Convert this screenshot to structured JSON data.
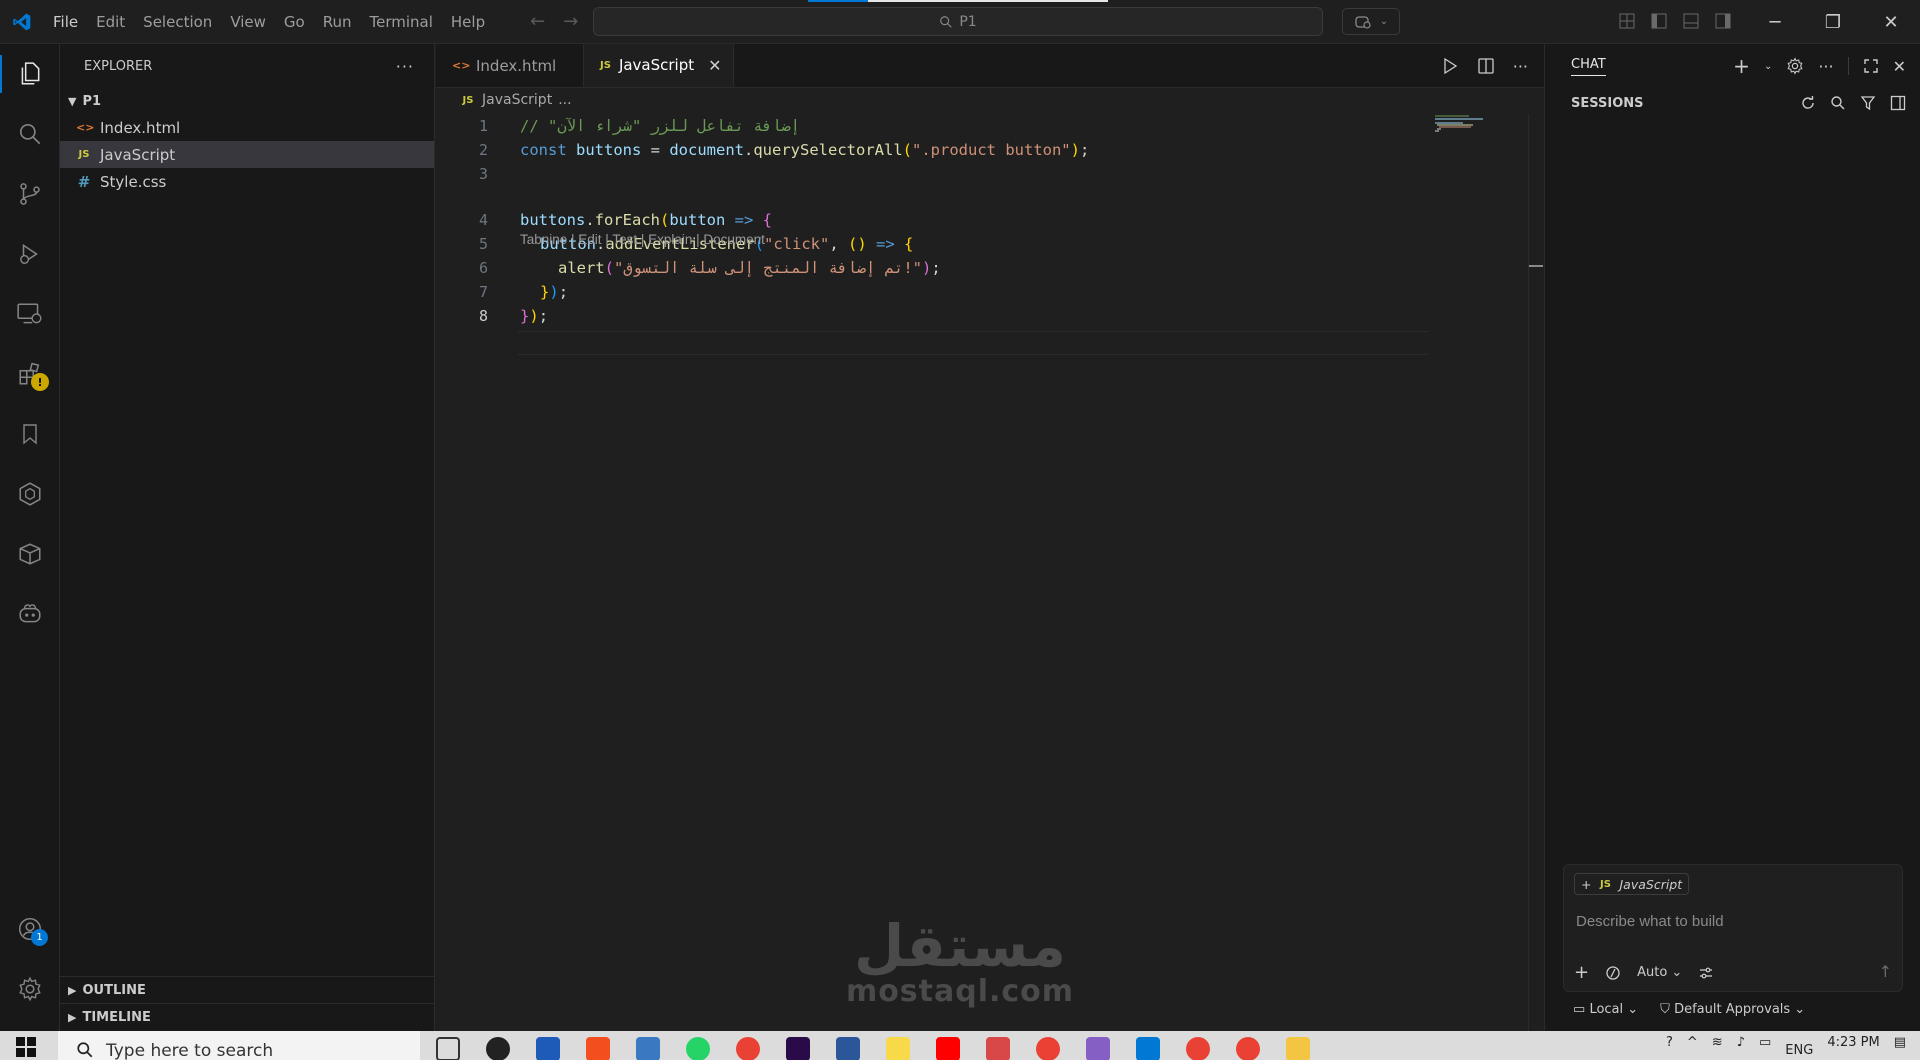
{
  "titlebar": {
    "menu": [
      "File",
      "Edit",
      "Selection",
      "View",
      "Go",
      "Run",
      "Terminal",
      "Help"
    ],
    "search_text": "P1"
  },
  "activity": {
    "accounts_badge": "1"
  },
  "sidebar": {
    "title": "EXPLORER",
    "folder": "P1",
    "files": [
      {
        "name": "Index.html",
        "icon": "html-file-icon"
      },
      {
        "name": "JavaScript",
        "icon": "js-file-icon"
      },
      {
        "name": "Style.css",
        "icon": "css-file-icon"
      }
    ],
    "outline_label": "OUTLINE",
    "timeline_label": "TIMELINE"
  },
  "editor": {
    "tabs": [
      {
        "label": "Index.html",
        "icon_text": "<>"
      },
      {
        "label": "JavaScript",
        "icon_text": "JS"
      }
    ],
    "breadcrumb_icon": "JS",
    "breadcrumb_file": "JavaScript",
    "breadcrumb_more": "...",
    "codelens": "Tabnine | Edit | Test | Explain | Document",
    "line_numbers": [
      "1",
      "2",
      "3",
      "4",
      "5",
      "6",
      "7",
      "8"
    ],
    "code": {
      "l1_comment": "// \"إضافة تفاعل للزر \"شراء الآن",
      "l2_kw": "const",
      "l2_var": "buttons",
      "l2_eq": " = ",
      "l2_obj": "document",
      "l2_dot": ".",
      "l2_fn": "querySelectorAll",
      "l2_p": "(",
      "l2_str": "\".product button\"",
      "l2_end": ");",
      "l4_var": "buttons",
      "l4_dot": ".",
      "l4_fn": "forEach",
      "l4_p": "(",
      "l4_arg": "button",
      "l4_arrow": " => ",
      "l4_brace": "{",
      "l5_var": "button",
      "l5_dot": ".",
      "l5_fn": "addEventListener",
      "l5_p": "(",
      "l5_str": "\"click\"",
      "l5_comma": ", ",
      "l5_paren": "()",
      "l5_arrow": " => ",
      "l5_brace": "{",
      "l6_fn": "alert",
      "l6_p": "(",
      "l6_str": "\"تم إضافة المنتج إلى سلة التسوق!\"",
      "l6_pc": ")",
      "l6_semi": ";",
      "l7_brace": "}",
      "l7_pc": ")",
      "l7_semi": ";",
      "l8_brace": "}",
      "l8_pc": ")",
      "l8_semi": ";"
    }
  },
  "chat": {
    "title": "CHAT",
    "sessions_label": "SESSIONS",
    "context_chip": "JavaScript",
    "context_chip_icon": "JS",
    "placeholder": "Describe what to build",
    "mode": "Auto",
    "footer_local": "Local",
    "footer_approvals": "Default Approvals"
  },
  "watermark": {
    "arabic": "مستقل",
    "latin": "mostaql.com"
  },
  "taskbar": {
    "search_placeholder": "Type here to search",
    "language": "ENG",
    "time": "4:23 PM"
  },
  "colors": {
    "accent": "#0078d4",
    "editor_bg": "#1f1f1f",
    "sidebar_bg": "#181818"
  }
}
